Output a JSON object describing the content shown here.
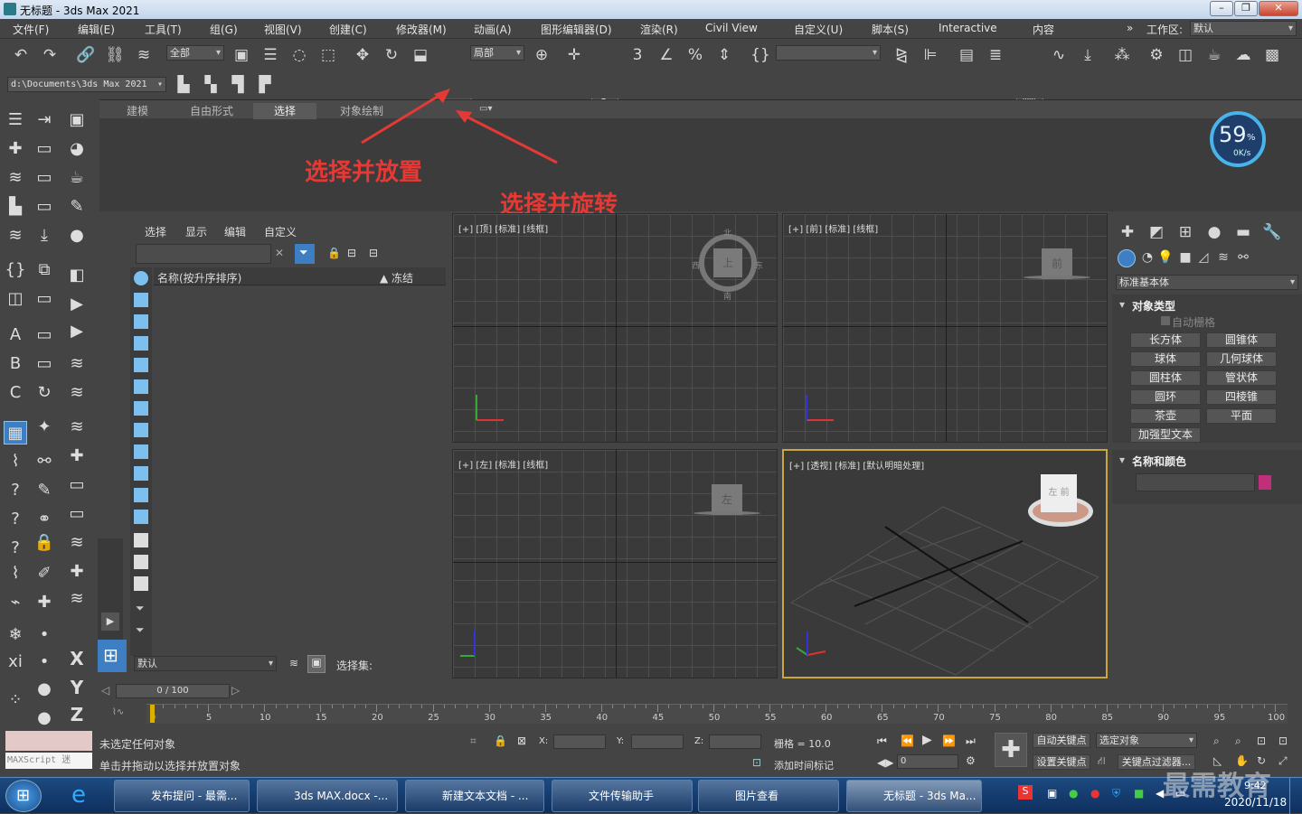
{
  "titlebar": {
    "title": "无标题 - 3ds Max 2021"
  },
  "menu": [
    "文件(F)",
    "编辑(E)",
    "工具(T)",
    "组(G)",
    "视图(V)",
    "创建(C)",
    "修改器(M)",
    "动画(A)",
    "图形编辑器(D)",
    "渲染(R)",
    "Civil View",
    "自定义(U)",
    "脚本(S)",
    "Interactive",
    "内容"
  ],
  "workspace": {
    "label": "工作区:",
    "value": "默认"
  },
  "toolbar": {
    "filter_value": "全部",
    "coord_value": "局部"
  },
  "path": {
    "value": "d:\\Documents\\3ds Max 2021"
  },
  "ribbon_tabs": [
    "建模",
    "自由形式",
    "选择",
    "对象绘制"
  ],
  "perf": {
    "value": "59",
    "unit": "%",
    "rate": "0K/s"
  },
  "annotations": {
    "place": "选择并放置",
    "rotate": "选择并旋转"
  },
  "scene": {
    "menu": [
      "选择",
      "显示",
      "编辑",
      "自定义"
    ],
    "col_name": "名称(按升序排序)",
    "col_freeze": "▲ 冻结",
    "layer_value": "默认",
    "selset_label": "选择集:"
  },
  "viewports": {
    "top": "[+] [顶] [标准] [线框]",
    "front": "[+] [前] [标准] [线框]",
    "left": "[+] [左] [标准] [线框]",
    "persp": "[+] [透视] [标准] [默认明暗处理]",
    "top_cube": "上",
    "front_cube": "前",
    "left_cube": "左",
    "persp_cube_a": "左",
    "persp_cube_b": "前",
    "north": "北",
    "south": "南",
    "west": "西",
    "east": "东"
  },
  "cmd": {
    "category": "标准基本体",
    "object_type": "对象类型",
    "autogrid": "自动栅格",
    "buttons": [
      "长方体",
      "圆锥体",
      "球体",
      "几何球体",
      "圆柱体",
      "管状体",
      "圆环",
      "四棱锥",
      "茶壶",
      "平面",
      "加强型文本"
    ],
    "name_color": "名称和颜色",
    "color": "#c0307a"
  },
  "timeline": {
    "frame": "0 / 100",
    "ticks": [
      "0",
      "5",
      "10",
      "15",
      "20",
      "25",
      "30",
      "35",
      "40",
      "45",
      "50",
      "55",
      "60",
      "65",
      "70",
      "75",
      "80",
      "85",
      "90",
      "95",
      "100"
    ]
  },
  "status": {
    "maxscript": "MAXScript 迷",
    "line1": "未选定任何对象",
    "line2": "单击并拖动以选择并放置对象",
    "x": "X:",
    "y": "Y:",
    "z": "Z:",
    "grid": "栅格 = 10.0",
    "addtime": "添加时间标记",
    "autokey": "自动关键点",
    "setkey": "设置关键点",
    "selected": "选定对象",
    "keyfilter": "关键点过滤器...",
    "frame": "0"
  },
  "taskbar": {
    "items": [
      "发布提问 - 最需...",
      "3ds MAX.docx -...",
      "新建文本文档 - ...",
      "文件传输助手",
      "图片查看",
      "无标题 - 3ds Ma..."
    ],
    "time": "9:42",
    "date": "2020/11/18",
    "watermark": "最需教育"
  }
}
